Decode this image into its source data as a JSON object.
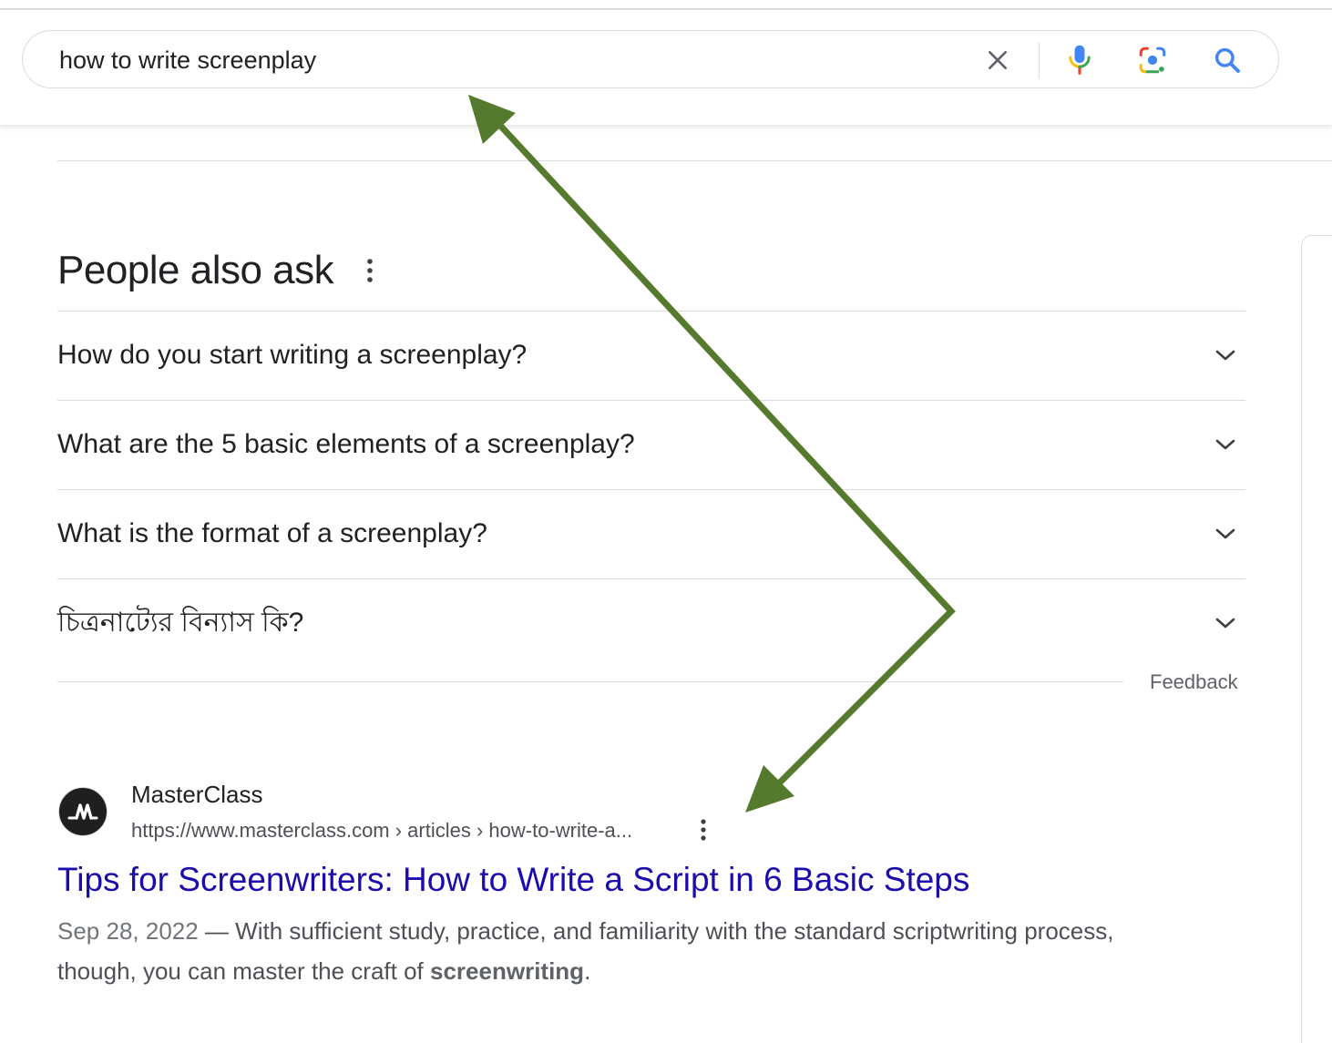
{
  "search": {
    "query": "how to write screenplay"
  },
  "people_also_ask": {
    "title": "People also ask",
    "questions": [
      "How do you start writing a screenplay?",
      "What are the 5 basic elements of a screenplay?",
      "What is the format of a screenplay?",
      "চিত্রনাট্যের বিন্যাস কি?"
    ],
    "feedback_label": "Feedback"
  },
  "result": {
    "favicon_letters": "M",
    "site_name": "MasterClass",
    "url": "https://www.masterclass.com › articles › how-to-write-a...",
    "title": "Tips for Screenwriters: How to Write a Script in 6 Basic Steps",
    "date": "Sep 28, 2022",
    "snippet_lead": " — With sufficient study, practice, and familiarity with the standard scriptwriting process, though, you can master the craft of ",
    "snippet_bold": "screenwriting",
    "snippet_end": "."
  },
  "icons": {
    "clear": "close-icon",
    "voice": "microphone-icon",
    "image_search": "camera-lens-icon",
    "submit": "search-icon",
    "more": "more-vertical-icon",
    "expand": "chevron-down-icon",
    "favicon": "masterclass-logo-icon"
  },
  "colors": {
    "link": "#1a0dab",
    "search_blue": "#4285f4",
    "annotation_arrow": "#557a2e",
    "divider": "#dadce0"
  }
}
